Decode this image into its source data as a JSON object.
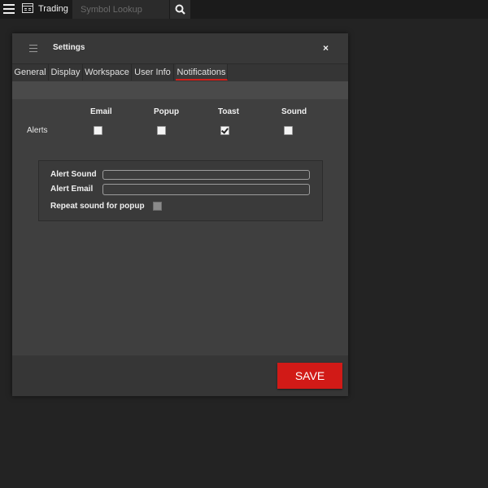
{
  "topbar": {
    "app_title": "Trading",
    "search": {
      "placeholder": "Symbol Lookup",
      "value": ""
    }
  },
  "dialog": {
    "title": "Settings",
    "close_label": "×",
    "tabs": [
      {
        "label": "General",
        "active": false
      },
      {
        "label": "Display",
        "active": false
      },
      {
        "label": "Workspace",
        "active": false
      },
      {
        "label": "User Info",
        "active": false
      },
      {
        "label": "Notifications",
        "active": true
      }
    ],
    "notifications": {
      "columns": [
        "Email",
        "Popup",
        "Toast",
        "Sound"
      ],
      "rows": [
        {
          "label": "Alerts",
          "values": [
            false,
            false,
            true,
            false
          ]
        }
      ],
      "alert_sound_label": "Alert Sound",
      "alert_sound_value": "",
      "alert_email_label": "Alert Email",
      "alert_email_value": "",
      "repeat_label": "Repeat sound for popup",
      "repeat_checked": false
    },
    "save_label": "SAVE"
  },
  "colors": {
    "background": "#232323",
    "dialog": "#3f3f3f",
    "accent": "#d11a17"
  },
  "icons": [
    "menu-icon",
    "trading-window-icon",
    "search-icon",
    "close-icon"
  ]
}
